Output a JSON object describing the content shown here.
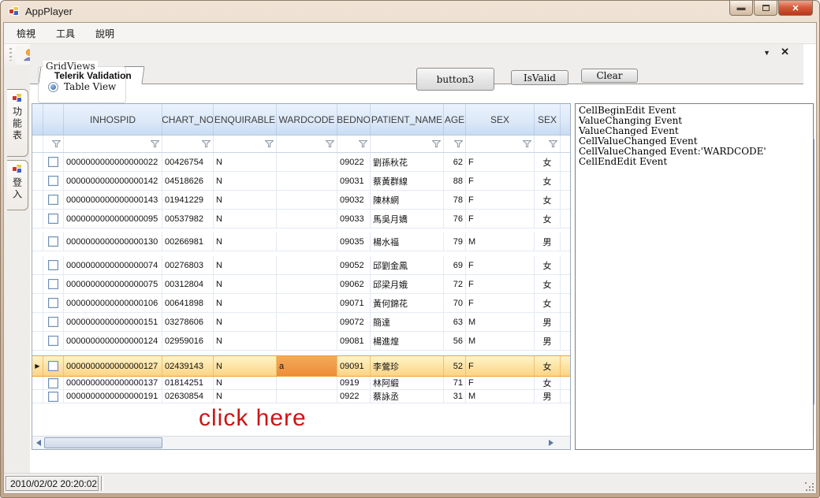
{
  "window": {
    "title": "AppPlayer"
  },
  "menu": {
    "items": [
      {
        "label": "檢視"
      },
      {
        "label": "工具"
      },
      {
        "label": "說明"
      }
    ]
  },
  "side_tabs": [
    {
      "label": "功能表"
    },
    {
      "label": "登入"
    }
  ],
  "doc_tab": {
    "label": "Telerik Validation"
  },
  "panel": {
    "groupbox_label": "GridViews",
    "radio_label": "Table View",
    "radio_selected": true,
    "button3_label": "button3",
    "isvalid_label": "IsValid",
    "clear_label": "Clear"
  },
  "grid": {
    "columns": [
      "",
      "",
      "INHOSPID",
      "CHART_NO",
      "ENQUIRABLE",
      "WARDCODE",
      "BEDNO",
      "PATIENT_NAME",
      "AGE",
      "SEX",
      "SEX"
    ],
    "selected_index": 10,
    "rows": [
      {
        "inhospid": "0000000000000000022",
        "chart_no": "00426754",
        "enquirable": "N",
        "wardcode": "",
        "bedno": "09022",
        "patient_name": "劉孫秋花",
        "age": "62",
        "sex": "F",
        "sex2": "女",
        "selected": false
      },
      {
        "inhospid": "0000000000000000142",
        "chart_no": "04518626",
        "enquirable": "N",
        "wardcode": "",
        "bedno": "09031",
        "patient_name": "蔡黃群線",
        "age": "88",
        "sex": "F",
        "sex2": "女",
        "selected": false
      },
      {
        "inhospid": "0000000000000000143",
        "chart_no": "01941229",
        "enquirable": "N",
        "wardcode": "",
        "bedno": "09032",
        "patient_name": "陳林網",
        "age": "78",
        "sex": "F",
        "sex2": "女",
        "selected": false
      },
      {
        "inhospid": "0000000000000000095",
        "chart_no": "00537982",
        "enquirable": "N",
        "wardcode": "",
        "bedno": "09033",
        "patient_name": "馬吳月嬌",
        "age": "76",
        "sex": "F",
        "sex2": "女",
        "selected": false
      },
      {
        "inhospid": "0000000000000000130",
        "chart_no": "00266981",
        "enquirable": "N",
        "wardcode": "",
        "bedno": "09035",
        "patient_name": "楊水福",
        "age": "79",
        "sex": "M",
        "sex2": "男",
        "selected": false
      },
      {
        "inhospid": "0000000000000000074",
        "chart_no": "00276803",
        "enquirable": "N",
        "wardcode": "",
        "bedno": "09052",
        "patient_name": "邱劉金鳳",
        "age": "69",
        "sex": "F",
        "sex2": "女",
        "selected": false
      },
      {
        "inhospid": "0000000000000000075",
        "chart_no": "00312804",
        "enquirable": "N",
        "wardcode": "",
        "bedno": "09062",
        "patient_name": "邱梁月娥",
        "age": "72",
        "sex": "F",
        "sex2": "女",
        "selected": false
      },
      {
        "inhospid": "0000000000000000106",
        "chart_no": "00641898",
        "enquirable": "N",
        "wardcode": "",
        "bedno": "09071",
        "patient_name": "黃何錦花",
        "age": "70",
        "sex": "F",
        "sex2": "女",
        "selected": false
      },
      {
        "inhospid": "0000000000000000151",
        "chart_no": "03278606",
        "enquirable": "N",
        "wardcode": "",
        "bedno": "09072",
        "patient_name": "簡達",
        "age": "63",
        "sex": "M",
        "sex2": "男",
        "selected": false
      },
      {
        "inhospid": "0000000000000000124",
        "chart_no": "02959016",
        "enquirable": "N",
        "wardcode": "",
        "bedno": "09081",
        "patient_name": "楊進煌",
        "age": "56",
        "sex": "M",
        "sex2": "男",
        "selected": false
      },
      {
        "inhospid": "0000000000000000127",
        "chart_no": "02439143",
        "enquirable": "N",
        "wardcode": "a",
        "bedno": "09091",
        "patient_name": "李鶯珍",
        "age": "52",
        "sex": "F",
        "sex2": "女",
        "selected": true,
        "edited_cell": "wardcode"
      },
      {
        "inhospid": "0000000000000000137",
        "chart_no": "01814251",
        "enquirable": "N",
        "wardcode": "",
        "bedno": "0919",
        "patient_name": "林阿緞",
        "age": "71",
        "sex": "F",
        "sex2": "女",
        "selected": false
      },
      {
        "inhospid": "0000000000000000191",
        "chart_no": "02630854",
        "enquirable": "N",
        "wardcode": "",
        "bedno": "0922",
        "patient_name": "蔡詠丞",
        "age": "31",
        "sex": "M",
        "sex2": "男",
        "selected": false
      }
    ]
  },
  "event_log": {
    "lines": [
      "CellBeginEdit Event",
      "ValueChanging Event",
      "ValueChanged Event",
      "CellValueChanged Event",
      "CellValueChanged Event:'WARDCODE'",
      "CellEndEdit Event"
    ]
  },
  "annotation": {
    "click_here": "click here"
  },
  "statusbar": {
    "datetime": "2010/02/02 20:20:02"
  },
  "colors": {
    "selected_row": "#fbd484",
    "edited_cell": "#ee8d36",
    "header_blue": "#c8dcf3",
    "close_red": "#b8371a",
    "annotation_red": "#cc1414"
  }
}
